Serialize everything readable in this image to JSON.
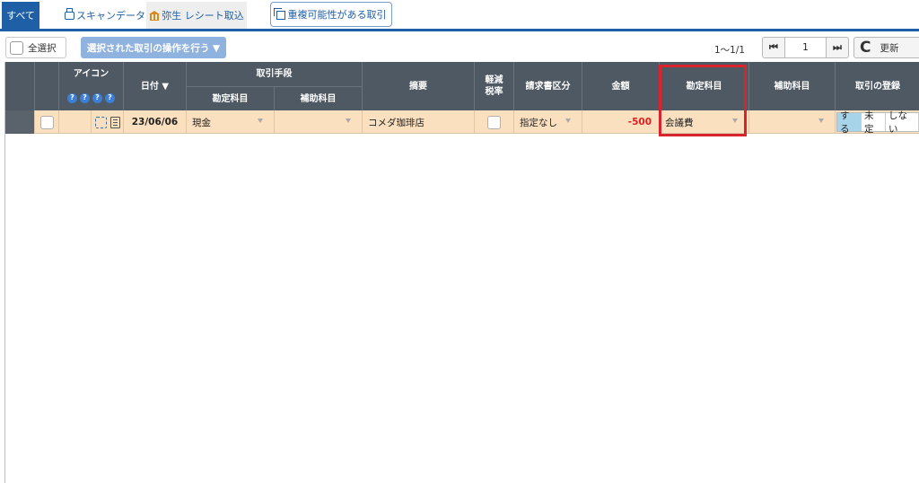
{
  "tabs": {
    "all": "すべて",
    "scan": "スキャンデータ",
    "yayoi": "弥生 レシート取込",
    "duplicate": "重複可能性がある取引"
  },
  "toolbar": {
    "select_all": "全選択",
    "bulk_action": "選択された取引の操作を行う ▼",
    "paging": "1～1/1",
    "page": "1",
    "first_icon": "⏮",
    "last_icon": "⏭",
    "refresh_icon": "C",
    "refresh": "更新"
  },
  "headers": {
    "icon": "アイコン",
    "q": "?",
    "date": "日付 ▼",
    "payment": "取引手段",
    "payment_account": "勘定科目",
    "payment_sub": "補助科目",
    "summary": "摘要",
    "reduced_tax_1": "軽減",
    "reduced_tax_2": "税率",
    "invoice": "請求書区分",
    "amount": "金額",
    "account": "勘定科目",
    "sub_account": "補助科目",
    "register": "取引の登録"
  },
  "rows": [
    {
      "date": "23/06/06",
      "payment_account": "現金",
      "payment_sub": "",
      "summary": "コメダ珈琲店",
      "invoice": "指定なし",
      "amount": "-500",
      "account": "会議費",
      "sub_account": "",
      "register_yes": "する",
      "register_pending": "未定",
      "register_no": "しない"
    }
  ],
  "colors": {
    "accent": "#1f5fa6",
    "header_bg": "#4f5963",
    "row_bg": "#fbe0bf",
    "amount": "#e02020",
    "highlight": "#d9232d"
  }
}
